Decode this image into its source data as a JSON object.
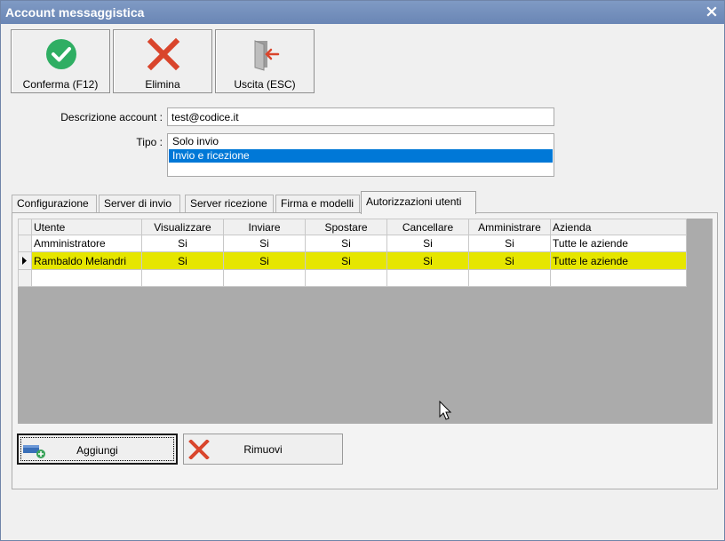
{
  "window": {
    "title": "Account messaggistica"
  },
  "toolbar": {
    "confirm_label": "Conferma (F12)",
    "delete_label": "Elimina",
    "exit_label": "Uscita (ESC)"
  },
  "form": {
    "description_label": "Descrizione account :",
    "description_value": "test@codice.it",
    "type_label": "Tipo :",
    "type_options": [
      "Solo invio",
      "Invio e ricezione"
    ],
    "type_selected": "Invio e ricezione"
  },
  "tabs": [
    {
      "label": "Configurazione"
    },
    {
      "label": "Server di invio"
    },
    {
      "label": "Server ricezione"
    },
    {
      "label": "Firma e modelli"
    },
    {
      "label": "Autorizzazioni utenti"
    }
  ],
  "active_tab": "Autorizzazioni utenti",
  "grid": {
    "columns": [
      "Utente",
      "Visualizzare",
      "Inviare",
      "Spostare",
      "Cancellare",
      "Amministrare",
      "Azienda"
    ],
    "rows": [
      [
        "Amministratore",
        "Si",
        "Si",
        "Si",
        "Si",
        "Si",
        "Tutte le aziende"
      ],
      [
        "Rambaldo Melandri",
        "Si",
        "Si",
        "Si",
        "Si",
        "Si",
        "Tutte le aziende"
      ]
    ]
  },
  "actions": {
    "add_label": "Aggiungi",
    "remove_label": "Rimuovi"
  },
  "colors": {
    "title_bar": "#6f8ab8",
    "selected_row": "#e6e600",
    "list_selection": "#0078d7",
    "grid_background": "#ababab",
    "confirm_icon": "#2fae63",
    "delete_icon": "#d9452c"
  },
  "icons": {
    "close": "close-icon",
    "confirm": "checkmark-circle-icon",
    "delete": "red-x-icon",
    "exit": "exit-door-icon",
    "add": "add-user-icon",
    "remove": "red-x-icon",
    "row_indicator": "row-pointer-icon"
  }
}
